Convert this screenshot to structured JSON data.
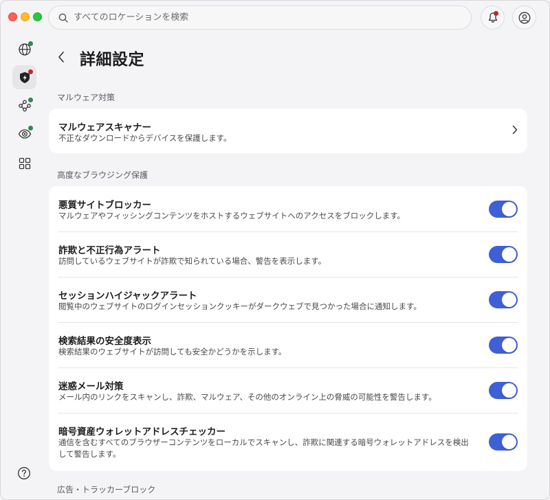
{
  "search": {
    "placeholder": "すべてのロケーションを検索"
  },
  "page": {
    "title": "詳細設定"
  },
  "sections": {
    "malware": {
      "label": "マルウェア対策",
      "scanner": {
        "title": "マルウェアスキャナー",
        "desc": "不正なダウンロードからデバイスを保護します。"
      }
    },
    "browsing": {
      "label": "高度なブラウジング保護",
      "items": [
        {
          "title": "悪質サイトブロッカー",
          "desc": "マルウェアやフィッシングコンテンツをホストするウェブサイトへのアクセスをブロックします。",
          "enabled": true
        },
        {
          "title": "詐欺と不正行為アラート",
          "desc": "訪問しているウェブサイトが詐欺で知られている場合、警告を表示します。",
          "enabled": true
        },
        {
          "title": "セッションハイジャックアラート",
          "desc": "閲覧中のウェブサイトのログインセッションクッキーがダークウェブで見つかった場合に通知します。",
          "enabled": true
        },
        {
          "title": "検索結果の安全度表示",
          "desc": "検索結果のウェブサイトが訪問しても安全かどうかを示します。",
          "enabled": true
        },
        {
          "title": "迷惑メール対策",
          "desc": "メール内のリンクをスキャンし、詐欺、マルウェア、その他のオンライン上の脅威の可能性を警告します。",
          "enabled": true
        },
        {
          "title": "暗号資産ウォレットアドレスチェッカー",
          "desc": "通信を含むすべてのブラウザーコンテンツをローカルでスキャンし、詐欺に関連する暗号ウォレットアドレスを検出して警告します。",
          "enabled": true
        }
      ]
    },
    "ads": {
      "label": "広告・トラッカーブロック"
    }
  },
  "sidebar": {
    "items": [
      {
        "icon": "globe-icon",
        "status": "green"
      },
      {
        "icon": "shield-bolt-icon",
        "status": "red",
        "active": true
      },
      {
        "icon": "network-icon",
        "status": "green"
      },
      {
        "icon": "eye-icon",
        "status": "green"
      },
      {
        "icon": "apps-grid-icon"
      }
    ]
  },
  "colors": {
    "accent": "#3f5fd6",
    "alert": "#c0272d",
    "ok": "#2d8a4e",
    "background": "#f4f4f6",
    "card": "#ffffff"
  }
}
